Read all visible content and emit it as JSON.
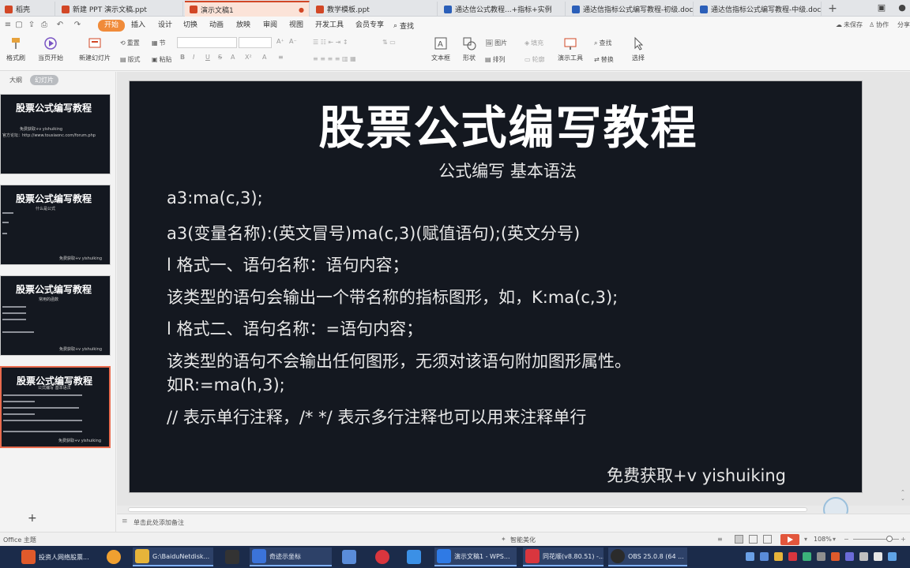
{
  "tabs": [
    {
      "label": "稻壳",
      "icon_color": "#d24726"
    },
    {
      "label": "新建 PPT 演示文稿.ppt",
      "icon_color": "#d24726"
    },
    {
      "label": "演示文稿1",
      "icon_color": "#d24726",
      "active": true
    },
    {
      "label": "教学模板.ppt",
      "icon_color": "#d24726"
    },
    {
      "label": "通达信公式教程...+指标+实例",
      "icon_color": "#2b5fb9"
    },
    {
      "label": "通达信指标公式编写教程-初级.doc",
      "icon_color": "#2b5fb9"
    },
    {
      "label": "通达信指标公式编写教程-中级.doc",
      "icon_color": "#2b5fb9"
    }
  ],
  "menu": {
    "items": [
      "开始",
      "插入",
      "设计",
      "切换",
      "动画",
      "放映",
      "审阅",
      "视图",
      "开发工具",
      "会员专享"
    ],
    "active": "开始",
    "search": "查找",
    "right": [
      "未保存",
      "协作",
      "分享"
    ]
  },
  "ribbon": {
    "big": [
      "格式刷",
      "当页开始",
      "新建幻灯片",
      "版式",
      "文本框",
      "形状",
      "演示工具",
      "选择"
    ],
    "small": {
      "paste": "粘贴",
      "reset": "重置",
      "section": "节",
      "picture": "图片",
      "arrange": "排列",
      "find": "查找",
      "replace": "替换",
      "fill": "填充",
      "outline": "轮廓"
    },
    "format_buttons": [
      "B",
      "I",
      "U",
      "S",
      "A",
      "X²",
      "A",
      "≡"
    ]
  },
  "left_panel": {
    "tab_outline": "大纲",
    "tab_slides": "幻灯片",
    "thumbnails": [
      {
        "title": "股票公式编写教程",
        "subtitle": "免费获取+v yishuiking",
        "extra": "官方论坛：http://www.tousiaonc.com/forum.php"
      },
      {
        "title": "股票公式编写教程",
        "subtitle": "什么是公式",
        "extra": "免费获取+v yishuiking"
      },
      {
        "title": "股票公式编写教程",
        "subtitle": "常用的函数",
        "extra": "免费获取+v yishuiking"
      },
      {
        "title": "股票公式编写教程",
        "subtitle": "公式编写 基本语法",
        "extra": "免费获取+v yishuiking"
      }
    ],
    "add_label": "+"
  },
  "slide": {
    "title": "股票公式编写教程",
    "subtitle": "公式编写 基本语法",
    "lines": [
      "a3:ma(c,3);",
      "a3(变量名称):(英文冒号)ma(c,3)(赋值语句);(英文分号)",
      "l  格式一、语句名称：语句内容；",
      "该类型的语句会输出一个带名称的指标图形，如，K:ma(c,3);",
      "l  格式二、语句名称：=语句内容；",
      "该类型的语句不会输出任何图形，无须对该语句附加图形属性。",
      "如R:=ma(h,3);",
      "// 表示单行注释，/* */ 表示多行注释也可以用来注释单行"
    ],
    "footer": "免费获取+v  yishuiking"
  },
  "notes_placeholder": "单击此处添加备注",
  "status": {
    "theme": "Office 主题",
    "smart": "智能美化",
    "zoom": "108%"
  },
  "taskbar": [
    {
      "label": "投资人网络股票...",
      "color": "#e05a2b"
    },
    {
      "label": "",
      "color": "#f0a030"
    },
    {
      "label": "G:\\BaiduNetdisk...",
      "color": "#e6b43a"
    },
    {
      "label": "",
      "color": "#333333"
    },
    {
      "label": "奇迹示坐标",
      "color": "#3b73d9"
    },
    {
      "label": "",
      "color": "#5a8cd9"
    },
    {
      "label": "",
      "color": "#d9363e"
    },
    {
      "label": "",
      "color": "#3b90e6"
    },
    {
      "label": "演示文稿1 - WPS...",
      "color": "#2f7ae5"
    },
    {
      "label": "同花顺(v8.80.51) -...",
      "color": "#d9363e"
    },
    {
      "label": "OBS 25.0.8 (64 ...",
      "color": "#2b2b2b"
    }
  ]
}
